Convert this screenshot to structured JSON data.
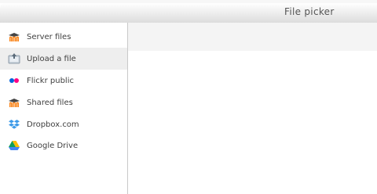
{
  "dialog": {
    "title": "File picker"
  },
  "sidebar": {
    "items": [
      {
        "label": "Server files",
        "icon": "moodle-icon"
      },
      {
        "label": "Upload a file",
        "icon": "upload-icon",
        "active": true
      },
      {
        "label": "Flickr public",
        "icon": "flickr-icon"
      },
      {
        "label": "Shared files",
        "icon": "moodle-icon"
      },
      {
        "label": "Dropbox.com",
        "icon": "dropbox-icon"
      },
      {
        "label": "Google Drive",
        "icon": "google-drive-icon"
      }
    ]
  },
  "colors": {
    "active_item_bg": "#eeeeee",
    "moodle_orange": "#f98012",
    "flickr_pink": "#ff0084",
    "flickr_blue": "#0063dc",
    "dropbox_blue": "#3d9ae8"
  }
}
